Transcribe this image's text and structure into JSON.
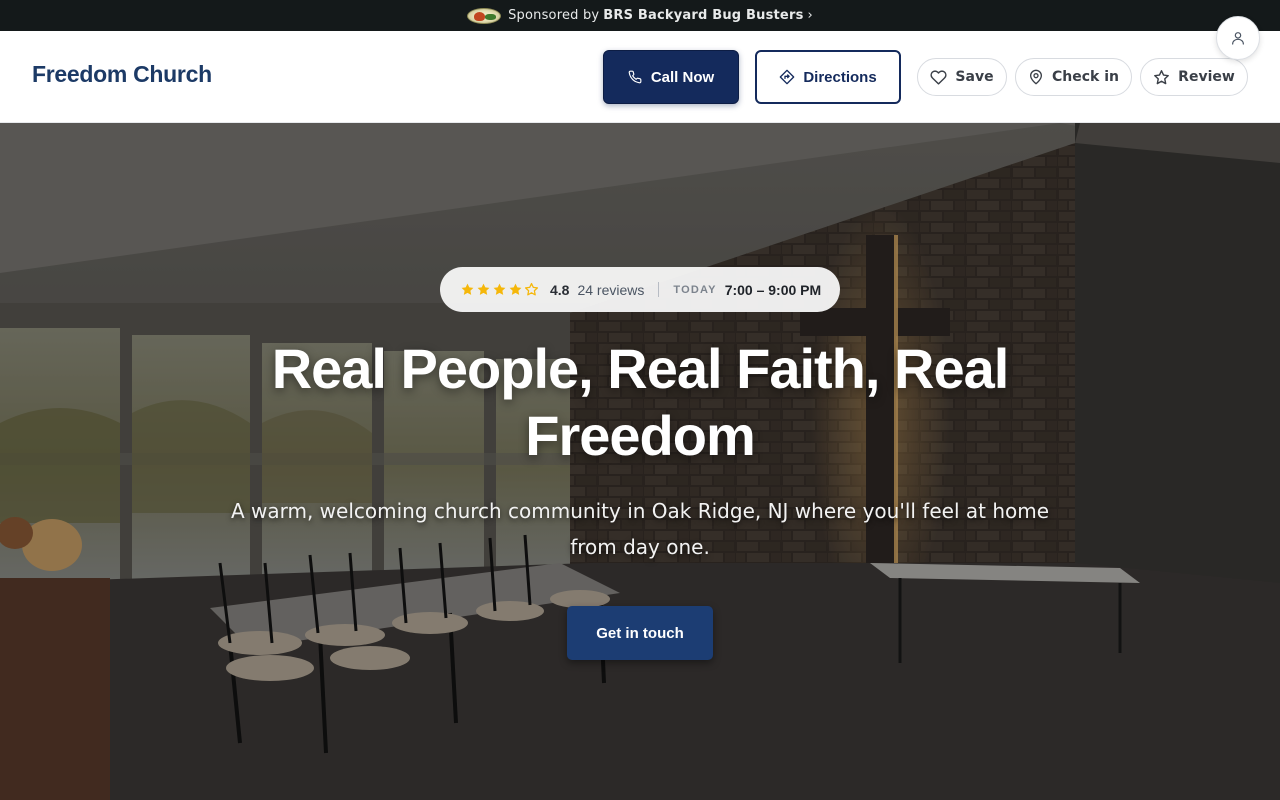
{
  "sponsor": {
    "prefix": "Sponsored by",
    "name": "BRS Backyard Bug Busters",
    "chevron": "›",
    "logo_icon": "sponsor-logo"
  },
  "header": {
    "brand": "Freedom Church",
    "call_label": "Call Now",
    "directions_label": "Directions",
    "save_label": "Save",
    "checkin_label": "Check in",
    "review_label": "Review",
    "icons": [
      "phone-icon",
      "directions-icon",
      "heart-icon",
      "map-pin-icon",
      "star-icon",
      "user-icon"
    ]
  },
  "hero": {
    "rating": "4.8",
    "rating_value": 4.8,
    "rating_max": 5,
    "reviews": "24 reviews",
    "today_label": "TODAY",
    "hours": "7:00 – 9:00 PM",
    "title": "Real People, Real Faith, Real Freedom",
    "subtitle": "A warm, welcoming church community in Oak Ridge, NJ where you'll feel at home from day one.",
    "cta_label": "Get in touch"
  },
  "colors": {
    "brand_navy": "#142a5c",
    "brand_text": "#1c3a66",
    "star_gold": "#f5b70a",
    "sponsor_bar": "#14191a"
  }
}
